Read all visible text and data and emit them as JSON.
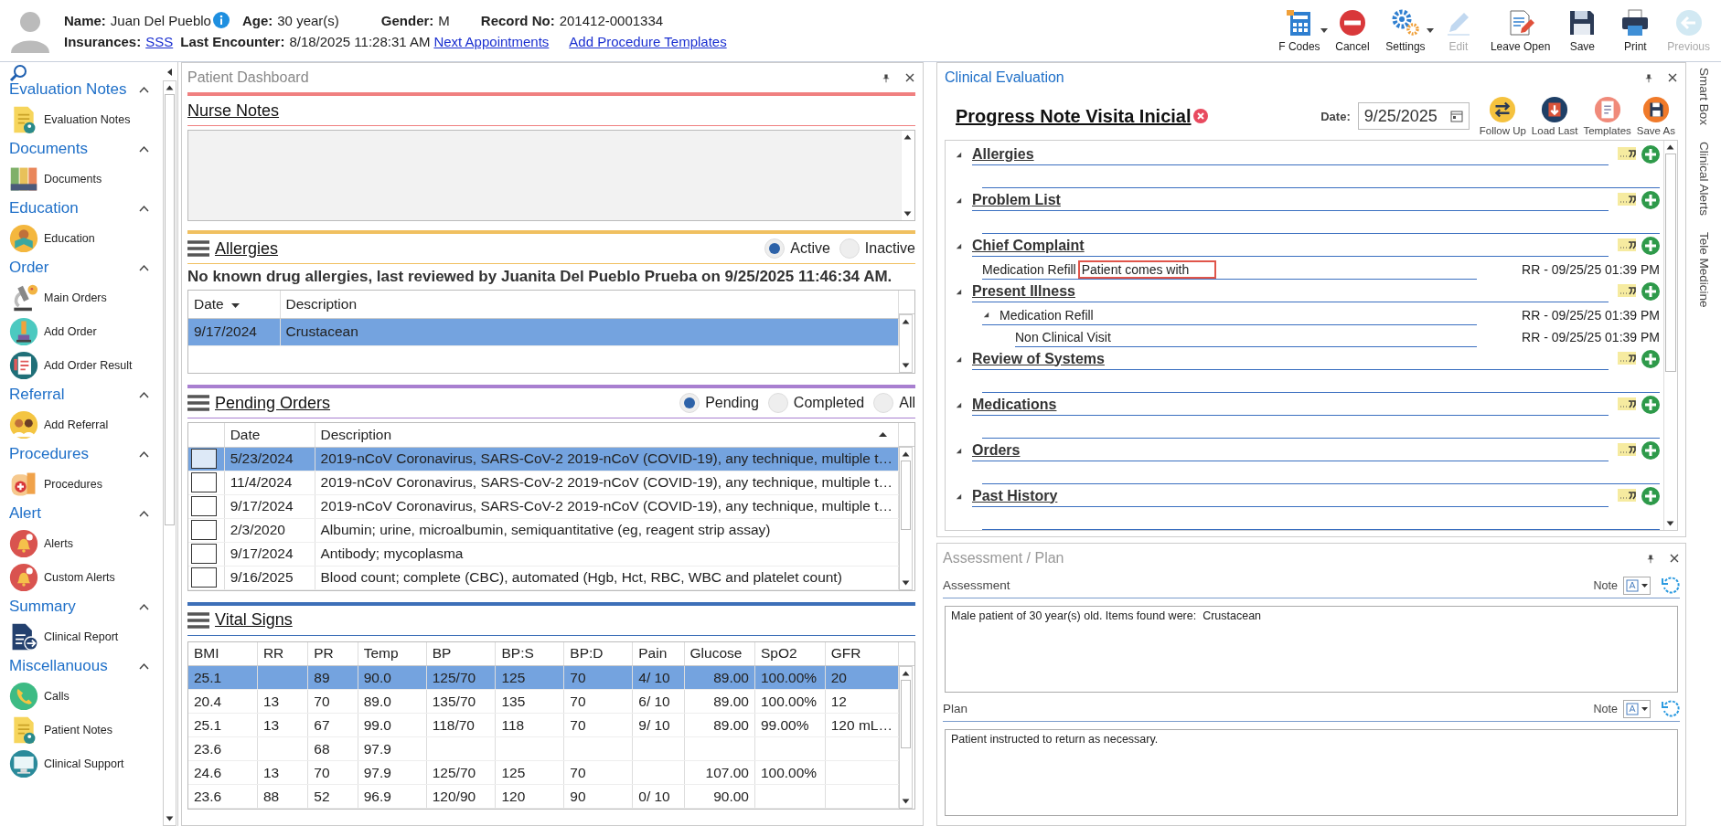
{
  "patient": {
    "name_label": "Name:",
    "name": "Juan Del Pueblo",
    "age_label": "Age:",
    "age": "30 year(s)",
    "gender_label": "Gender:",
    "gender": "M",
    "record_label": "Record No:",
    "record": "201412-0001334",
    "insurance_label": "Insurances:",
    "insurance": "SSS",
    "encounter_label": "Last Encounter:",
    "encounter": "8/18/2025 11:28:31 AM",
    "links": [
      "Next Appointments",
      "Add Procedure Templates"
    ]
  },
  "toolbar": [
    {
      "label": "F Codes",
      "kind": "fcodes",
      "has_menu": true,
      "disabled": false
    },
    {
      "label": "Cancel",
      "kind": "cancel",
      "has_menu": false,
      "disabled": false
    },
    {
      "label": "Settings",
      "kind": "settings",
      "has_menu": true,
      "disabled": false
    },
    {
      "label": "Edit",
      "kind": "edit",
      "has_menu": false,
      "disabled": true
    },
    {
      "label": "Leave Open",
      "kind": "leave",
      "has_menu": false,
      "disabled": false
    },
    {
      "label": "Save",
      "kind": "save",
      "has_menu": false,
      "disabled": false
    },
    {
      "label": "Print",
      "kind": "print",
      "has_menu": false,
      "disabled": false
    },
    {
      "label": "Previous",
      "kind": "previous",
      "has_menu": false,
      "disabled": true
    }
  ],
  "sidebar": {
    "groups": [
      {
        "title": "Evaluation Notes",
        "expanded": true,
        "items": [
          {
            "label": "Evaluation Notes",
            "kind": "note"
          }
        ]
      },
      {
        "title": "Documents",
        "expanded": true,
        "items": [
          {
            "label": "Documents",
            "kind": "binders"
          }
        ]
      },
      {
        "title": "Education",
        "expanded": true,
        "items": [
          {
            "label": "Education",
            "kind": "reader"
          }
        ]
      },
      {
        "title": "Order",
        "expanded": true,
        "items": [
          {
            "label": "Main Orders",
            "kind": "microscope"
          },
          {
            "label": "Add Order",
            "kind": "flask"
          },
          {
            "label": "Add Order Result",
            "kind": "clipboard"
          }
        ]
      },
      {
        "title": "Referral",
        "expanded": true,
        "items": [
          {
            "label": "Add Referral",
            "kind": "people"
          }
        ]
      },
      {
        "title": "Procedures",
        "expanded": true,
        "items": [
          {
            "label": "Procedures",
            "kind": "bandage"
          }
        ]
      },
      {
        "title": "Alert",
        "expanded": true,
        "items": [
          {
            "label": "Alerts",
            "kind": "bell"
          },
          {
            "label": "Custom Alerts",
            "kind": "bell"
          }
        ]
      },
      {
        "title": "Summary",
        "expanded": true,
        "items": [
          {
            "label": "Clinical Report",
            "kind": "report"
          }
        ]
      },
      {
        "title": "Miscellanuous",
        "expanded": true,
        "items": [
          {
            "label": "Calls",
            "kind": "phone"
          },
          {
            "label": "Patient Notes",
            "kind": "note"
          },
          {
            "label": "Clinical Support",
            "kind": "monitor"
          }
        ]
      }
    ]
  },
  "dashboard": {
    "title": "Patient Dashboard",
    "nurse_notes": {
      "title": "Nurse Notes"
    },
    "allergies": {
      "title": "Allergies",
      "filters": [
        {
          "label": "Active",
          "selected": true
        },
        {
          "label": "Inactive",
          "selected": false
        }
      ],
      "statement": "No known drug allergies, last reviewed by Juanita Del Pueblo Prueba on 9/25/2025 11:46:34 AM.",
      "columns": [
        "Date",
        "Description"
      ],
      "rows": [
        {
          "cells": [
            "9/17/2024",
            "Crustacean"
          ],
          "selected": true
        }
      ]
    },
    "pending_orders": {
      "title": "Pending Orders",
      "filters": [
        {
          "label": "Pending",
          "selected": true
        },
        {
          "label": "Completed",
          "selected": false
        },
        {
          "label": "All",
          "selected": false
        }
      ],
      "columns": [
        "Date",
        "Description"
      ],
      "rows": [
        {
          "checked": false,
          "selected": true,
          "cells": [
            "5/23/2024",
            "2019-nCoV Coronavirus, SARS-CoV-2 2019-nCoV (COVID-19), any technique, multiple t…"
          ]
        },
        {
          "checked": false,
          "selected": false,
          "cells": [
            "11/4/2024",
            "2019-nCoV Coronavirus, SARS-CoV-2 2019-nCoV (COVID-19), any technique, multiple t…"
          ]
        },
        {
          "checked": false,
          "selected": false,
          "cells": [
            "9/17/2024",
            "2019-nCoV Coronavirus, SARS-CoV-2 2019-nCoV (COVID-19), any technique, multiple t…"
          ]
        },
        {
          "checked": false,
          "selected": false,
          "cells": [
            "2/3/2020",
            "Albumin; urine, microalbumin, semiquantitative (eg, reagent strip assay)"
          ]
        },
        {
          "checked": false,
          "selected": false,
          "cells": [
            "9/17/2024",
            "Antibody; mycoplasma"
          ]
        },
        {
          "checked": false,
          "selected": false,
          "cells": [
            "9/16/2025",
            "Blood count; complete (CBC), automated (Hgb, Hct, RBC, WBC and platelet count)"
          ]
        }
      ]
    },
    "vital_signs": {
      "title": "Vital Signs",
      "columns": [
        "BMI",
        "RR",
        "PR",
        "Temp",
        "BP",
        "BP:S",
        "BP:D",
        "Pain",
        "Glucose",
        "SpO2",
        "GFR"
      ],
      "rows": [
        {
          "selected": true,
          "cells": [
            "25.1",
            "",
            "89",
            "90.0",
            "125/70",
            "125",
            "70",
            "4/ 10",
            "89.00",
            "100.00%",
            "20"
          ]
        },
        {
          "selected": false,
          "cells": [
            "20.4",
            "13",
            "70",
            "89.0",
            "135/70",
            "135",
            "70",
            "6/ 10",
            "89.00",
            "100.00%",
            "12"
          ]
        },
        {
          "selected": false,
          "cells": [
            "25.1",
            "13",
            "67",
            "99.0",
            "118/70",
            "118",
            "70",
            "9/ 10",
            "89.00",
            "99.00%",
            "120 mL…"
          ]
        },
        {
          "selected": false,
          "cells": [
            "23.6",
            "",
            "68",
            "97.9",
            "",
            "",
            "",
            "",
            "",
            "",
            ""
          ]
        },
        {
          "selected": false,
          "cells": [
            "24.6",
            "13",
            "70",
            "97.9",
            "125/70",
            "125",
            "70",
            "",
            "107.00",
            "100.00%",
            ""
          ]
        },
        {
          "selected": false,
          "cells": [
            "23.6",
            "88",
            "52",
            "96.9",
            "120/90",
            "120",
            "90",
            "0/ 10",
            "90.00",
            "",
            ""
          ]
        }
      ]
    }
  },
  "clinical_evaluation": {
    "title": "Clinical Evaluation",
    "note_title": "Progress Note Visita Inicial",
    "date_label": "Date:",
    "date": "9/25/2025",
    "actions": [
      {
        "label": "Follow Up",
        "kind": "follow"
      },
      {
        "label": "Load Last",
        "kind": "load"
      },
      {
        "label": "Templates",
        "kind": "templates"
      },
      {
        "label": "Save As",
        "kind": "saveas"
      }
    ],
    "sections": [
      {
        "title": "Allergies",
        "expanded": true
      },
      {
        "title": "Problem List",
        "expanded": true
      },
      {
        "title": "Chief Complaint",
        "expanded": true,
        "children": [
          {
            "label": "Medication Refill",
            "value": "Patient comes with",
            "stamp": "RR - 09/25/25 01:39 PM"
          }
        ]
      },
      {
        "title": "Present Illness",
        "expanded": true,
        "children": [
          {
            "label": "Medication Refill",
            "expanded": true,
            "stamp": "RR - 09/25/25 01:39 PM",
            "children": [
              {
                "label": "Non Clinical Visit",
                "stamp": "RR - 09/25/25 01:39 PM"
              }
            ]
          }
        ]
      },
      {
        "title": "Review of Systems",
        "expanded": true
      },
      {
        "title": "Medications",
        "expanded": true
      },
      {
        "title": "Orders",
        "expanded": true
      },
      {
        "title": "Past History",
        "expanded": true
      }
    ]
  },
  "assessment_plan": {
    "title": "Assessment / Plan",
    "sections": [
      {
        "label": "Assessment",
        "note_label": "Note",
        "text": "Male patient of 30 year(s) old. Items found were:  Crustacean"
      },
      {
        "label": "Plan",
        "note_label": "Note",
        "text": "Patient instructed to return as necessary."
      }
    ]
  },
  "side_tabs": [
    "Smart Box",
    "Clinical Alerts",
    "Tele Medicine"
  ]
}
